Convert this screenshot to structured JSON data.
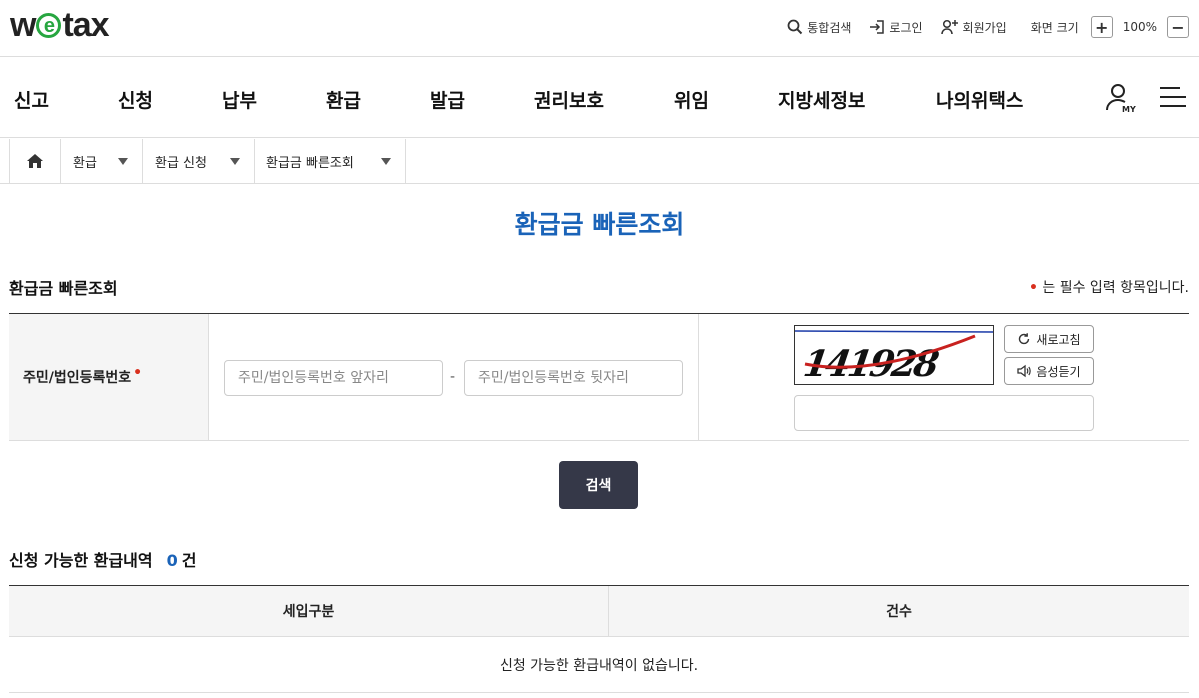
{
  "header": {
    "logo_pre": "w",
    "logo_e": "e",
    "logo_post": "tax",
    "util": {
      "search": "통합검색",
      "login": "로그인",
      "signup": "회원가입",
      "zoom_label": "화면 크기",
      "zoom_in": "+",
      "zoom_value": "100%",
      "zoom_out": "−"
    }
  },
  "gnb": {
    "items": [
      "신고",
      "신청",
      "납부",
      "환급",
      "발급",
      "권리보호",
      "위임",
      "지방세정보",
      "나의위택스"
    ],
    "my_label": "MY"
  },
  "breadcrumb": {
    "items": [
      "환급",
      "환급 신청",
      "환급금 빠른조회"
    ]
  },
  "page_title": "환급금 빠른조회",
  "form": {
    "section_title": "환급금 빠른조회",
    "required_marker": "•",
    "required_note": " 는 필수 입력 항목입니다.",
    "id_label": "주민/법인등록번호",
    "id_front_placeholder": "주민/법인등록번호 앞자리",
    "id_separator": "-",
    "id_back_placeholder": "주민/법인등록번호 뒷자리",
    "captcha_text": "141928",
    "refresh_label": "새로고침",
    "audio_label": "음성듣기",
    "captcha_input_value": "",
    "search_label": "검색"
  },
  "results": {
    "title": "신청 가능한 환급내역",
    "count": "0",
    "count_unit": "건",
    "columns": [
      "세입구분",
      "건수"
    ],
    "empty_message": "신청 가능한 환급내역이 없습니다."
  },
  "colors": {
    "accent_blue": "#1a63b8",
    "required_red": "#d9301e",
    "logo_green": "#27a640",
    "button_dark": "#353848"
  }
}
